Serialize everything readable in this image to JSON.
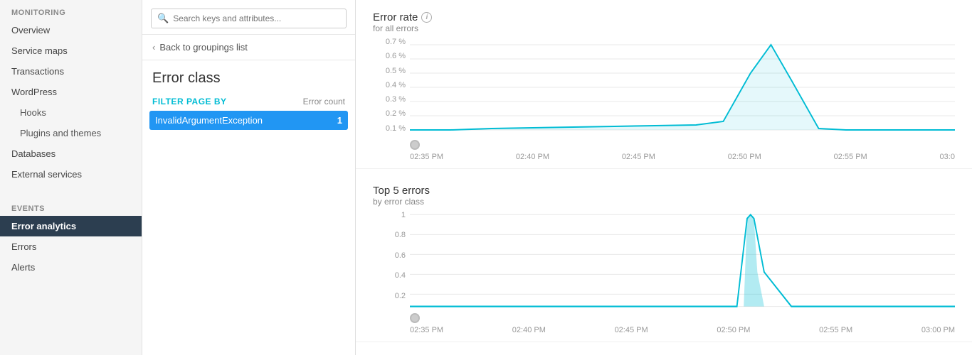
{
  "sidebar": {
    "monitoring_label": "MONITORING",
    "events_label": "EVENTS",
    "items_monitoring": [
      {
        "id": "overview",
        "label": "Overview",
        "indent": false,
        "active": false
      },
      {
        "id": "service-maps",
        "label": "Service maps",
        "indent": false,
        "active": false
      },
      {
        "id": "transactions",
        "label": "Transactions",
        "indent": false,
        "active": false
      },
      {
        "id": "wordpress",
        "label": "WordPress",
        "indent": false,
        "active": false
      },
      {
        "id": "hooks",
        "label": "Hooks",
        "indent": true,
        "active": false
      },
      {
        "id": "plugins-themes",
        "label": "Plugins and themes",
        "indent": true,
        "active": false
      },
      {
        "id": "databases",
        "label": "Databases",
        "indent": false,
        "active": false
      },
      {
        "id": "external-services",
        "label": "External services",
        "indent": false,
        "active": false
      }
    ],
    "items_events": [
      {
        "id": "error-analytics",
        "label": "Error analytics",
        "indent": false,
        "active": true
      },
      {
        "id": "errors",
        "label": "Errors",
        "indent": false,
        "active": false
      },
      {
        "id": "alerts",
        "label": "Alerts",
        "indent": false,
        "active": false
      }
    ]
  },
  "middle": {
    "search_placeholder": "Search keys and attributes...",
    "back_link": "Back to groupings list",
    "section_title": "Error class",
    "filter_label": "FILTER PAGE BY",
    "error_count_label": "Error count",
    "filter_items": [
      {
        "name": "InvalidArgumentException",
        "count": "1"
      }
    ]
  },
  "main": {
    "error_rate": {
      "title": "Error rate",
      "subtitle": "for all errors",
      "y_labels": [
        "0.7 %",
        "0.6 %",
        "0.5 %",
        "0.4 %",
        "0.3 %",
        "0.2 %",
        "0.1 %",
        ""
      ],
      "x_labels": [
        "02:35 PM",
        "02:40 PM",
        "02:45 PM",
        "02:50 PM",
        "02:55 PM",
        "03:0"
      ]
    },
    "top5": {
      "title": "Top 5 errors",
      "subtitle": "by error class",
      "y_labels": [
        "1",
        "0.8",
        "0.6",
        "0.4",
        "0.2",
        ""
      ],
      "x_labels": [
        "02:35 PM",
        "02:40 PM",
        "02:45 PM",
        "02:50 PM",
        "02:55 PM",
        "03:00 PM"
      ]
    }
  }
}
